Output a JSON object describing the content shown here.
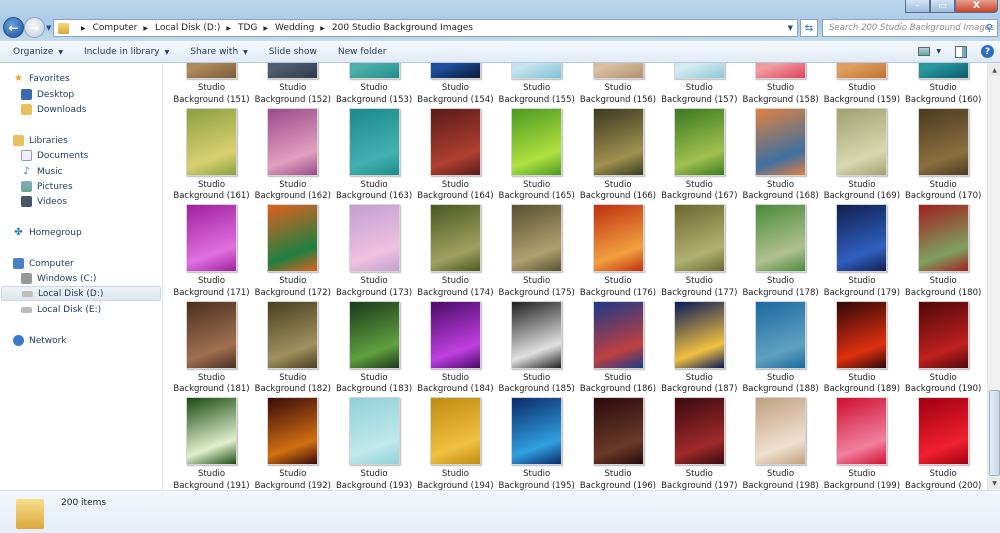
{
  "window": {
    "minimize": "–",
    "maximize": "▭",
    "close": "X"
  },
  "nav": {
    "back_icon": "arrow-left",
    "forward_icon": "arrow-right"
  },
  "address": {
    "breadcrumbs": [
      "Computer",
      "Local Disk (D:)",
      "TDG",
      "Wedding",
      "200 Studio Background Images"
    ]
  },
  "search": {
    "placeholder": "Search 200 Studio Background Images"
  },
  "toolbar": {
    "organize": "Organize",
    "include": "Include in library",
    "share": "Share with",
    "slideshow": "Slide show",
    "newfolder": "New folder",
    "help": "?"
  },
  "sidebar": {
    "favorites": "Favorites",
    "desktop": "Desktop",
    "downloads": "Downloads",
    "libraries": "Libraries",
    "documents": "Documents",
    "music": "Music",
    "pictures": "Pictures",
    "videos": "Videos",
    "homegroup": "Homegroup",
    "computer": "Computer",
    "windows_c": "Windows (C:)",
    "local_d": "Local Disk (D:)",
    "local_e": "Local Disk (E:)",
    "network": "Network"
  },
  "files": {
    "line1": "Studio",
    "items": [
      {
        "name": "Background (151)",
        "c": [
          "#7a5a3a",
          "#b08a5a"
        ]
      },
      {
        "name": "Background (152)",
        "c": [
          "#2a3a4a",
          "#506070"
        ]
      },
      {
        "name": "Background (153)",
        "c": [
          "#1f8c8a",
          "#4fb0a8"
        ]
      },
      {
        "name": "Background (154)",
        "c": [
          "#0b1a3a",
          "#2050a0"
        ]
      },
      {
        "name": "Background (155)",
        "c": [
          "#7fc0d8",
          "#c8e4ee"
        ]
      },
      {
        "name": "Background (156)",
        "c": [
          "#b09070",
          "#d8c0a0"
        ]
      },
      {
        "name": "Background (157)",
        "c": [
          "#8ec6d6",
          "#d6ecf2"
        ]
      },
      {
        "name": "Background (158)",
        "c": [
          "#e04060",
          "#f0a0a0"
        ]
      },
      {
        "name": "Background (159)",
        "c": [
          "#c07030",
          "#e0a060"
        ]
      },
      {
        "name": "Background (160)",
        "c": [
          "#0a5a6a",
          "#2a9aa0"
        ]
      },
      {
        "name": "Background (161)",
        "c": [
          "#8aa040",
          "#d8d070"
        ]
      },
      {
        "name": "Background (162)",
        "c": [
          "#9a4a8a",
          "#e0a0c0"
        ]
      },
      {
        "name": "Background (163)",
        "c": [
          "#1a8a8a",
          "#40b0b0"
        ]
      },
      {
        "name": "Background (164)",
        "c": [
          "#5a1a1a",
          "#b04030"
        ]
      },
      {
        "name": "Background (165)",
        "c": [
          "#4a9a20",
          "#b0e040"
        ]
      },
      {
        "name": "Background (166)",
        "c": [
          "#3a3a20",
          "#a09050"
        ]
      },
      {
        "name": "Background (167)",
        "c": [
          "#3a7a20",
          "#a0c050"
        ]
      },
      {
        "name": "Background (168)",
        "c": [
          "#e08040",
          "#4070a0"
        ]
      },
      {
        "name": "Background (169)",
        "c": [
          "#a0a070",
          "#d8d8b0"
        ]
      },
      {
        "name": "Background (170)",
        "c": [
          "#4a3a20",
          "#8a7040"
        ]
      },
      {
        "name": "Background (171)",
        "c": [
          "#a020a0",
          "#e070e0"
        ]
      },
      {
        "name": "Background (172)",
        "c": [
          "#e06020",
          "#208040"
        ]
      },
      {
        "name": "Background (173)",
        "c": [
          "#c0a0d0",
          "#f0c0e0"
        ]
      },
      {
        "name": "Background (174)",
        "c": [
          "#4a5a20",
          "#a0a060"
        ]
      },
      {
        "name": "Background (175)",
        "c": [
          "#5a5030",
          "#b0a070"
        ]
      },
      {
        "name": "Background (176)",
        "c": [
          "#c03010",
          "#f0a040"
        ]
      },
      {
        "name": "Background (177)",
        "c": [
          "#6a6a30",
          "#b0b070"
        ]
      },
      {
        "name": "Background (178)",
        "c": [
          "#4a8a3a",
          "#b0c090"
        ]
      },
      {
        "name": "Background (179)",
        "c": [
          "#102050",
          "#3060c0"
        ]
      },
      {
        "name": "Background (180)",
        "c": [
          "#a02020",
          "#80a060"
        ]
      },
      {
        "name": "Background (181)",
        "c": [
          "#4a3020",
          "#a07050"
        ]
      },
      {
        "name": "Background (182)",
        "c": [
          "#4a4020",
          "#a09060"
        ]
      },
      {
        "name": "Background (183)",
        "c": [
          "#1a3a1a",
          "#60a040"
        ]
      },
      {
        "name": "Background (184)",
        "c": [
          "#4a0a6a",
          "#c040e0"
        ]
      },
      {
        "name": "Background (185)",
        "c": [
          "#202020",
          "#e0e0e0"
        ]
      },
      {
        "name": "Background (186)",
        "c": [
          "#1a3a8a",
          "#c04040"
        ]
      },
      {
        "name": "Background (187)",
        "c": [
          "#0a1a5a",
          "#f0c040"
        ]
      },
      {
        "name": "Background (188)",
        "c": [
          "#1a6aa0",
          "#60a0c0"
        ]
      },
      {
        "name": "Background (189)",
        "c": [
          "#300808",
          "#e03010"
        ]
      },
      {
        "name": "Background (190)",
        "c": [
          "#500808",
          "#c02020"
        ]
      },
      {
        "name": "Background (191)",
        "c": [
          "#1a4a10",
          "#e0f0d0"
        ]
      },
      {
        "name": "Background (192)",
        "c": [
          "#3a0a0a",
          "#d07010"
        ]
      },
      {
        "name": "Background (193)",
        "c": [
          "#90d0d8",
          "#c0e8ec"
        ]
      },
      {
        "name": "Background (194)",
        "c": [
          "#c08a10",
          "#f0c040"
        ]
      },
      {
        "name": "Background (195)",
        "c": [
          "#0a2a6a",
          "#30a0e0"
        ]
      },
      {
        "name": "Background (196)",
        "c": [
          "#2a0a0a",
          "#6a3a2a"
        ]
      },
      {
        "name": "Background (197)",
        "c": [
          "#3a0a10",
          "#a02a2a"
        ]
      },
      {
        "name": "Background (198)",
        "c": [
          "#c0a080",
          "#f0e0d0"
        ]
      },
      {
        "name": "Background (199)",
        "c": [
          "#d01030",
          "#f080a0"
        ]
      },
      {
        "name": "Background (200)",
        "c": [
          "#a00010",
          "#f02030"
        ]
      }
    ]
  },
  "status": {
    "count": "200 items"
  }
}
